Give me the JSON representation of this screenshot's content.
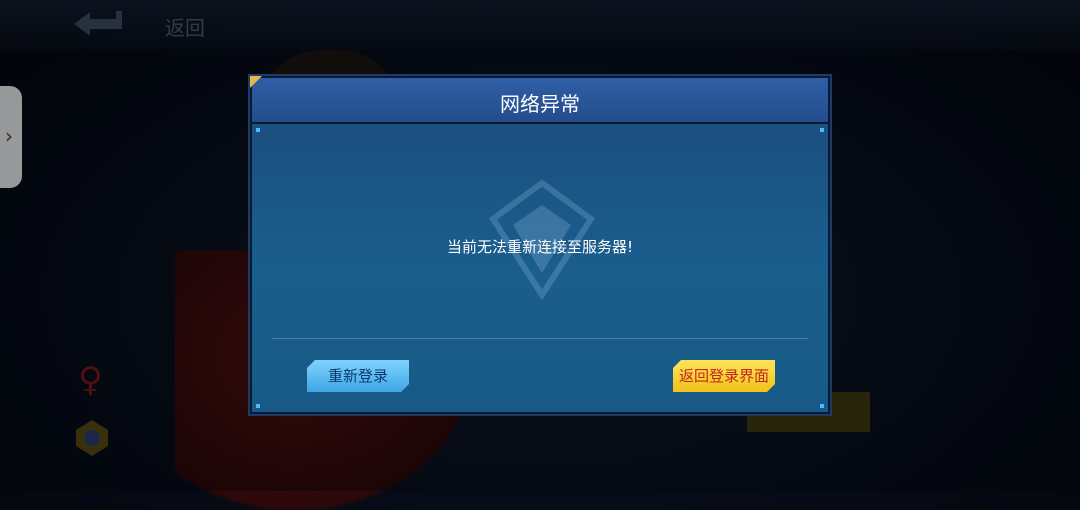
{
  "topbar": {
    "back_label": "返回"
  },
  "dialog": {
    "title": "网络异常",
    "message": "当前无法重新连接至服务器!",
    "relogin_button": "重新登录",
    "return_button": "返回登录界面"
  },
  "colors": {
    "header_blue": "#2f5fa6",
    "body_blue": "#1a5e8d",
    "relogin_button_cyan": "#7fd4ff",
    "return_button_yellow": "#ffe35a",
    "return_button_text": "#c2261a"
  },
  "icons": {
    "back": "back-arrow-icon",
    "side_tab": "chevron-right-icon",
    "gender": "female-icon",
    "badge": "medal-icon",
    "watermark": "shield-emblem-icon"
  }
}
